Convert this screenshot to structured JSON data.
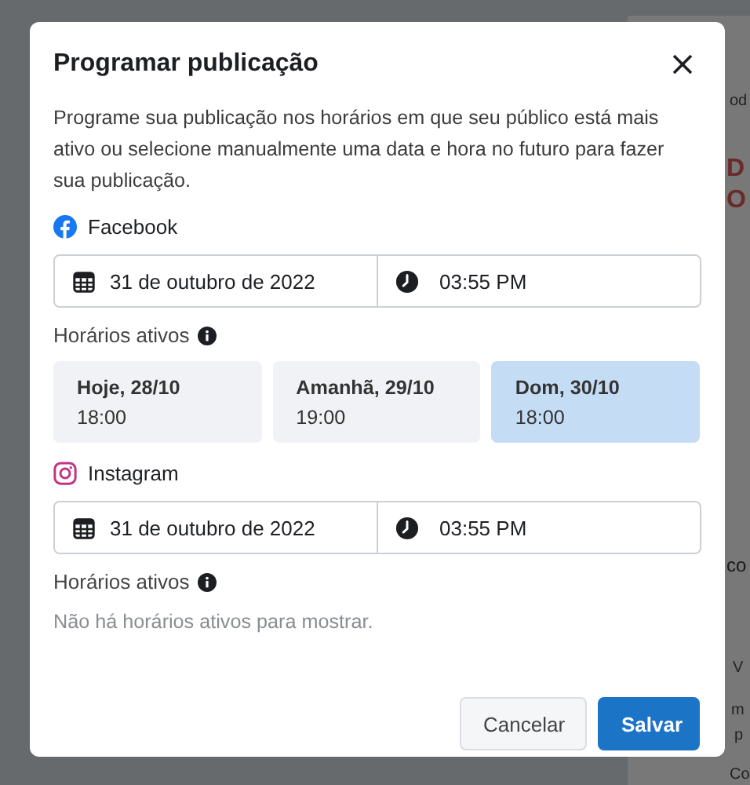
{
  "background": {
    "texts": [
      {
        "text": "od",
        "kind": "small"
      },
      {
        "text": "D",
        "kind": "headline"
      },
      {
        "text": "O",
        "kind": "headline"
      },
      {
        "text": "co",
        "kind": "medium"
      },
      {
        "text": "V",
        "kind": "small"
      },
      {
        "text": "m",
        "kind": "small"
      },
      {
        "text": "p",
        "kind": "small"
      },
      {
        "text": "Co",
        "kind": "small"
      }
    ]
  },
  "dialog": {
    "title": "Programar publicação",
    "description": "Programe sua publicação nos horários em que seu público está mais ativo ou selecione manualmente uma data e hora no futuro para fazer sua publicação.",
    "sections": [
      {
        "platform": "Facebook",
        "kind": "facebook",
        "date": "31 de outubro de 2022",
        "time": "03:55 PM",
        "active_label": "Horários ativos",
        "slots": [
          {
            "day": "Hoje, 28/10",
            "time": "18:00",
            "selected": false
          },
          {
            "day": "Amanhã, 29/10",
            "time": "19:00",
            "selected": false
          },
          {
            "day": "Dom, 30/10",
            "time": "18:00",
            "selected": true
          }
        ]
      },
      {
        "platform": "Instagram",
        "kind": "instagram",
        "date": "31 de outubro de 2022",
        "time": "03:55 PM",
        "active_label": "Horários ativos",
        "empty_message": "Não há horários ativos para mostrar."
      }
    ],
    "buttons": [
      {
        "label": "Cancelar",
        "kind": "secondary"
      },
      {
        "label": "Salvar",
        "kind": "primary"
      }
    ]
  }
}
